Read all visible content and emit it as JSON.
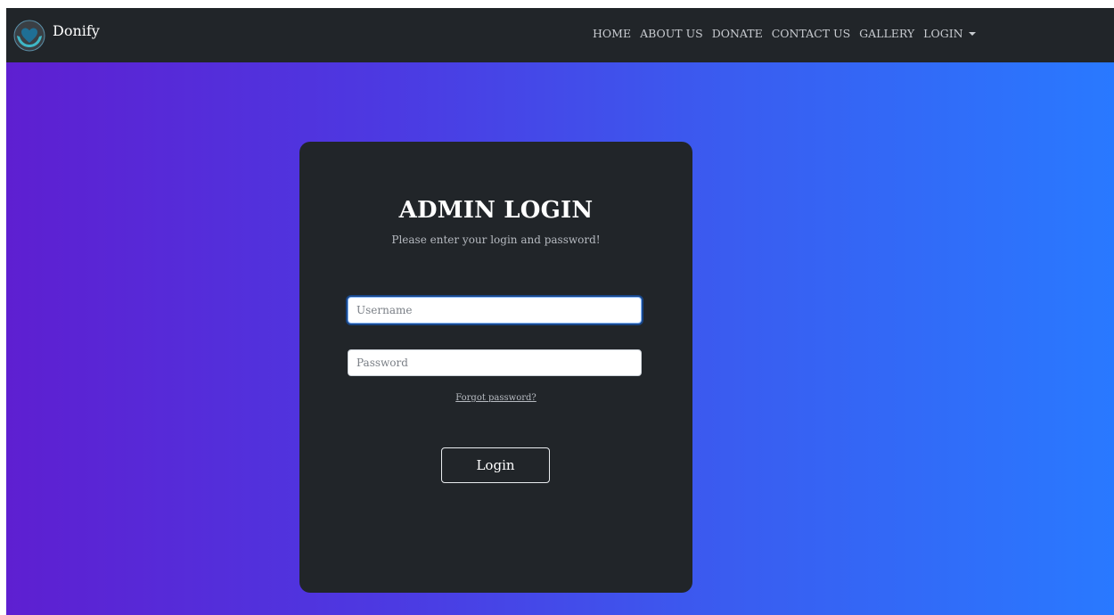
{
  "navbar": {
    "brand": "Donify",
    "links": [
      "HOME",
      "ABOUT US",
      "DONATE",
      "CONTACT US",
      "GALLERY"
    ],
    "dropdown_label": "LOGIN"
  },
  "login_card": {
    "title": "ADMIN LOGIN",
    "subtitle": "Please enter your login and password!",
    "username_placeholder": "Username",
    "password_placeholder": "Password",
    "forgot_link": "Forgot password?",
    "submit_label": "Login"
  },
  "icons": {
    "logo": "heart-in-hands-logo-icon",
    "dropdown": "caret-down-icon"
  },
  "colors": {
    "navbar_bg": "#212529",
    "card_bg": "#212529",
    "gradient_start": "#5e1fd1",
    "gradient_end": "#2979ff",
    "focus_ring": "#86b7fe"
  }
}
